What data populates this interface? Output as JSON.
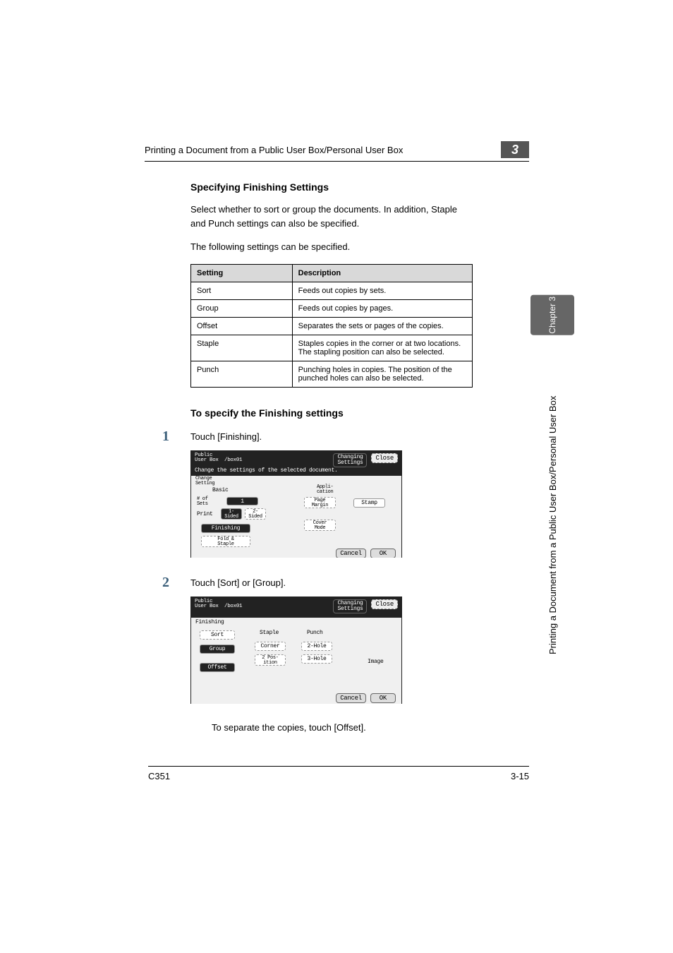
{
  "header": {
    "title": "Printing a Document from a Public User Box/Personal User Box",
    "chapter_num": "3"
  },
  "section1_title": "Specifying Finishing Settings",
  "intro1": "Select whether to sort or group the documents. In addition, Staple and Punch settings can also be specified.",
  "intro2": "The following settings can be specified.",
  "table": {
    "head_setting": "Setting",
    "head_desc": "Description",
    "rows": [
      {
        "s": "Sort",
        "d": "Feeds out copies by sets."
      },
      {
        "s": "Group",
        "d": "Feeds out copies by pages."
      },
      {
        "s": "Offset",
        "d": "Separates the sets or pages of the copies."
      },
      {
        "s": "Staple",
        "d": "Staples copies in the corner or at two locations. The stapling position can also be selected."
      },
      {
        "s": "Punch",
        "d": "Punching holes in copies. The position of the punched holes can also be selected."
      }
    ]
  },
  "section2_title": "To specify the Finishing settings",
  "steps": {
    "n1": "1",
    "t1": "Touch [Finishing].",
    "n2": "2",
    "t2": "Touch [Sort] or [Group].",
    "note": "To separate the copies, touch [Offset]."
  },
  "ss1": {
    "top_l1": "Public",
    "top_l2": "User Box",
    "box": "/box01",
    "changing": "Changing\nSettings",
    "close": "Close",
    "sub": "Change the settings of the selected document.",
    "tab": "Change\nSetting",
    "col_basic": "Basic",
    "col_app": "Appli-\ncation",
    "nof": "# of\nSets",
    "nof_val": "1",
    "print": "Print",
    "sided1": "1-\nSided",
    "sided2": "2-\nSided",
    "finishing": "Finishing",
    "fold": "Fold &\nStaple",
    "page_margin": "Page\nMargin",
    "cover": "Cover\nMode",
    "stamp": "Stamp",
    "cancel": "Cancel",
    "ok": "OK"
  },
  "ss2": {
    "top_l1": "Public",
    "top_l2": "User Box",
    "box": "/box01",
    "changing": "Changing\nSettings",
    "close": "Close",
    "tab": "Finishing",
    "sort": "Sort",
    "group": "Group",
    "offset": "Offset",
    "staple": "Staple",
    "corner": "Corner",
    "pos2": "2 Pos-\nition",
    "punch": "Punch",
    "h2": "2-Hole",
    "h3": "3-Hole",
    "image": "Image",
    "cancel": "Cancel",
    "ok": "OK"
  },
  "side": {
    "chapter": "Chapter 3",
    "label": "Printing a Document from a Public User Box/Personal User Box"
  },
  "footer": {
    "model": "C351",
    "page": "3-15"
  }
}
